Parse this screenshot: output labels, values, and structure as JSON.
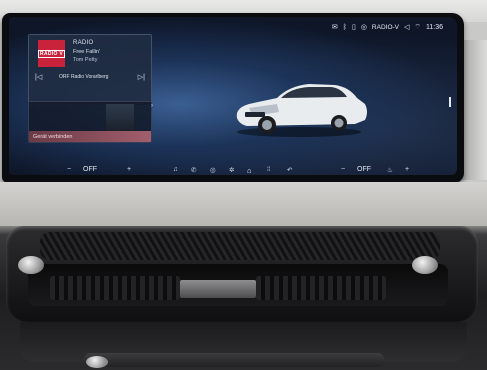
{
  "status_bar": {
    "icons": [
      "notification-icon",
      "bluetooth-icon",
      "phone-icon",
      "radio-icon",
      "volume-icon"
    ],
    "source": "RADIO-V",
    "time": "11:36"
  },
  "radio_widget": {
    "logo_text": "RADIO V",
    "source_label": "RADIO",
    "track": "Free Fallin'",
    "artist": "Tom Petty",
    "station": "ORF Radio Vorarlberg",
    "prev_icon": "skip-previous-icon",
    "next_icon": "skip-next-icon"
  },
  "media_widget": {
    "label": "Gerät verbinden"
  },
  "bottom_bar": {
    "left_climate": {
      "minus": "−",
      "value": "OFF",
      "plus": "+"
    },
    "right_climate": {
      "minus": "−",
      "value": "OFF",
      "plus": "+"
    },
    "nav_icons": [
      "music-icon",
      "phone-icon",
      "navigation-icon",
      "fan-icon",
      "home-icon",
      "apps-icon",
      "back-icon",
      "seat-heat-icon"
    ],
    "accent_color": "#d33c4a"
  }
}
